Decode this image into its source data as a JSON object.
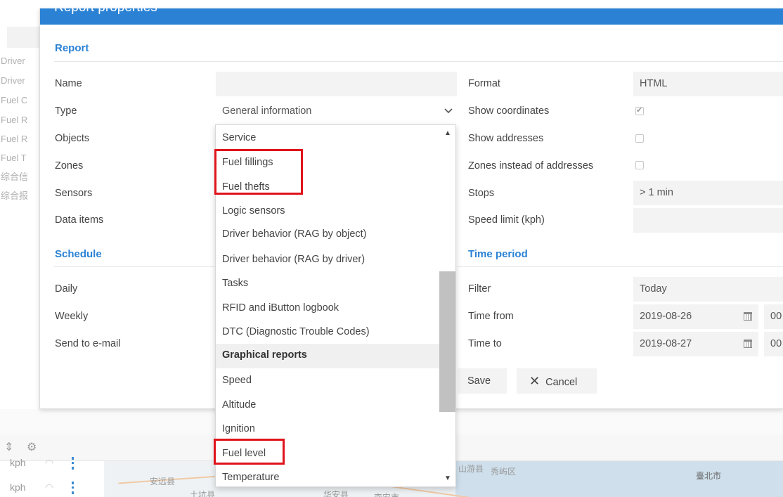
{
  "background": {
    "left_items": [
      "Driver",
      "Driver",
      "Fuel C",
      "Fuel R",
      "Fuel R",
      "Fuel T",
      "综合信",
      "综合报"
    ],
    "rows": [
      "kph",
      "kph"
    ],
    "map_labels": [
      "安远县",
      "土坑县",
      "华安县",
      "南安市",
      "山游县",
      "秀屿区",
      "臺北市"
    ]
  },
  "dialog": {
    "title": "Report properties",
    "sections": {
      "report": "Report",
      "schedule": "Schedule",
      "time_period": "Time period"
    },
    "left_labels": {
      "name": "Name",
      "type": "Type",
      "objects": "Objects",
      "zones": "Zones",
      "sensors": "Sensors",
      "data_items": "Data items",
      "daily": "Daily",
      "weekly": "Weekly",
      "send_to_email": "Send to e-mail"
    },
    "type_select": {
      "value": "General information",
      "options": [
        "Service",
        "Fuel fillings",
        "Fuel thefts",
        "Logic sensors",
        "Driver behavior (RAG by object)",
        "Driver behavior (RAG by driver)",
        "Tasks",
        "RFID and iButton logbook",
        "DTC (Diagnostic Trouble Codes)",
        "Graphical reports",
        "Speed",
        "Altitude",
        "Ignition",
        "Fuel level",
        "Temperature"
      ],
      "highlighted": [
        "Fuel fillings",
        "Fuel thefts",
        "Fuel level"
      ]
    },
    "right": {
      "format_label": "Format",
      "format_value": "HTML",
      "show_coordinates_label": "Show coordinates",
      "show_coordinates_checked": true,
      "show_addresses_label": "Show addresses",
      "show_addresses_checked": false,
      "zones_instead_label": "Zones instead of addresses",
      "zones_instead_checked": false,
      "stops_label": "Stops",
      "stops_value": "> 1 min",
      "speed_limit_label": "Speed limit (kph)",
      "speed_limit_value": "",
      "filter_label": "Filter",
      "filter_value": "Today",
      "time_from_label": "Time from",
      "time_from_date": "2019-08-26",
      "time_from_hour": "00",
      "time_to_label": "Time to",
      "time_to_date": "2019-08-27",
      "time_to_hour": "00"
    },
    "buttons": {
      "save": "Save",
      "cancel": "Cancel"
    }
  },
  "colors": {
    "header": "#2b82d4",
    "section_title": "#2b82d4",
    "highlight_box": "#e0131b"
  }
}
